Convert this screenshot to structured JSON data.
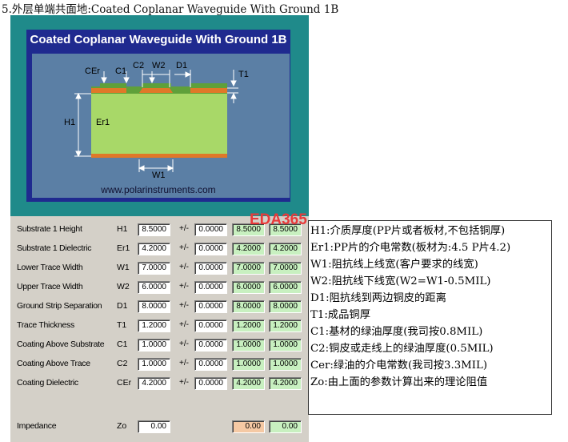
{
  "heading": "5.外层单端共面地:Coated Coplanar Waveguide With Ground 1B",
  "panel": {
    "title": "Coated Coplanar Waveguide With Ground 1B",
    "url": "www.polarinstruments.com",
    "labels": {
      "cer": "CEr",
      "c1": "C1",
      "c2": "C2",
      "w2": "W2",
      "d1": "D1",
      "t1": "T1",
      "h1": "H1",
      "er1": "Er1",
      "w1": "W1"
    }
  },
  "watermark": "EDA365",
  "rows": [
    {
      "label": "Substrate 1 Height",
      "symbol": "H1",
      "value": "8.5000",
      "pm": "+/-",
      "tol": "0.0000",
      "min": "8.5000",
      "max": "8.5000"
    },
    {
      "label": "Substrate 1 Dielectric",
      "symbol": "Er1",
      "value": "4.2000",
      "pm": "+/-",
      "tol": "0.0000",
      "min": "4.2000",
      "max": "4.2000"
    },
    {
      "label": "Lower Trace Width",
      "symbol": "W1",
      "value": "7.0000",
      "pm": "+/-",
      "tol": "0.0000",
      "min": "7.0000",
      "max": "7.0000"
    },
    {
      "label": "Upper Trace Width",
      "symbol": "W2",
      "value": "6.0000",
      "pm": "+/-",
      "tol": "0.0000",
      "min": "6.0000",
      "max": "6.0000"
    },
    {
      "label": "Ground Strip Separation",
      "symbol": "D1",
      "value": "8.0000",
      "pm": "+/-",
      "tol": "0.0000",
      "min": "8.0000",
      "max": "8.0000"
    },
    {
      "label": "Trace Thickness",
      "symbol": "T1",
      "value": "1.2000",
      "pm": "+/-",
      "tol": "0.0000",
      "min": "1.2000",
      "max": "1.2000"
    },
    {
      "label": "Coating Above Substrate",
      "symbol": "C1",
      "value": "1.0000",
      "pm": "+/-",
      "tol": "0.0000",
      "min": "1.0000",
      "max": "1.0000"
    },
    {
      "label": "Coating Above Trace",
      "symbol": "C2",
      "value": "1.0000",
      "pm": "+/-",
      "tol": "0.0000",
      "min": "1.0000",
      "max": "1.0000"
    },
    {
      "label": "Coating Dielectric",
      "symbol": "CEr",
      "value": "4.2000",
      "pm": "+/-",
      "tol": "0.0000",
      "min": "4.2000",
      "max": "4.2000"
    }
  ],
  "impedance": {
    "label": "Impedance",
    "symbol": "Zo",
    "value": "0.00",
    "min": "0.00",
    "max": "0.00"
  },
  "notes": [
    "H1:介质厚度(PP片或者板材,不包括铜厚)",
    "Er1:PP片的介电常数(板材为:4.5 P片4.2)",
    "W1:阻抗线上线宽(客户要求的线宽)",
    "W2:阻抗线下线宽(W2=W1-0.5MIL)",
    "D1:阻抗线到两边铜皮的距离",
    "T1:成品铜厚",
    "C1:基材的绿油厚度(我司按0.8MIL)",
    "C2:铜皮或走线上的绿油厚度(0.5MIL)",
    "Cer:绿油的介电常数(我司按3.3MIL)",
    "Zo:由上面的参数计算出来的理论阻值"
  ],
  "colors": {
    "teal": "#1f8a8a",
    "navy": "#1f2a8f",
    "substrate": "#a8d868",
    "copper": "#e07828",
    "coating": "#5fa03a"
  }
}
